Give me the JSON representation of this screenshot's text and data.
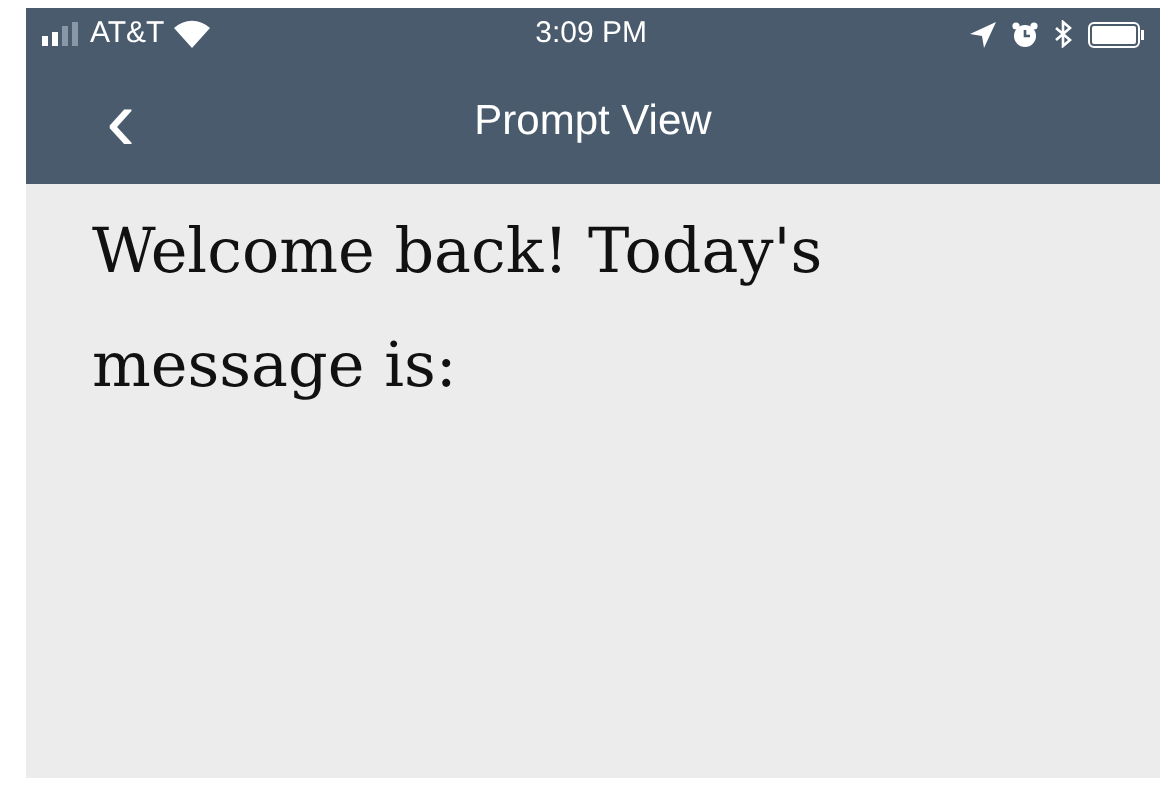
{
  "status_bar": {
    "carrier": "AT&T",
    "time": "3:09 PM"
  },
  "nav_bar": {
    "back": "‹",
    "title": "Prompt View"
  },
  "content": {
    "message": "Welcome back! Today's message is:"
  }
}
